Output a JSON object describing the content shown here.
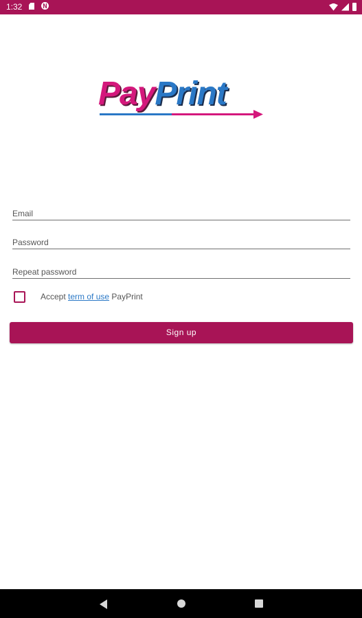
{
  "status_bar": {
    "time": "1:32",
    "background": "#a81456",
    "left_icons": [
      "sd-card-icon",
      "n-notification-icon"
    ],
    "right_icons": [
      "wifi-icon",
      "signal-icon",
      "battery-icon"
    ]
  },
  "logo": {
    "part1": "Pay",
    "part2": "Print",
    "colors": {
      "pay": "#d4187c",
      "print": "#2a78c6"
    }
  },
  "form": {
    "email_placeholder": "Email",
    "password_placeholder": "Password",
    "repeat_password_placeholder": "Repeat password",
    "terms": {
      "checked": false,
      "prefix": "Accept ",
      "link": "term of use",
      "suffix": " PayPrint"
    },
    "signup_label": "Sign up"
  },
  "colors": {
    "accent": "#a81456",
    "link": "#2a78c6"
  },
  "nav_bar": {
    "icons": [
      "back-icon",
      "home-icon",
      "recents-icon"
    ]
  }
}
